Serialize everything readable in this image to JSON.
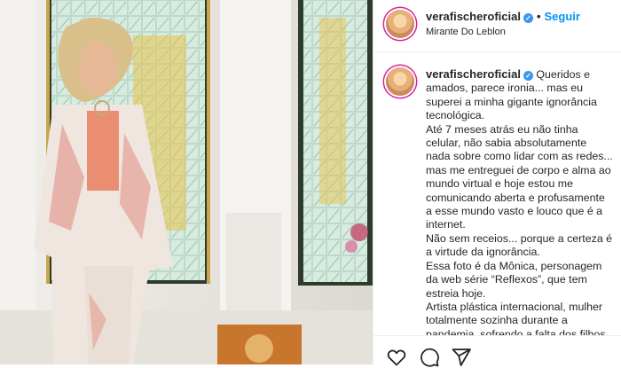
{
  "post": {
    "username": "verafischeroficial",
    "verified_mark": "✓",
    "follow_label": "Seguir",
    "location": "Mirante Do Leblon"
  },
  "caption": {
    "username": "verafischeroficial",
    "lines": [
      "Queridos e amados, parece ironia... mas eu superei a minha gigante ignorância tecnológica.",
      "Até 7 meses atrás eu não tinha celular, não sabia absolutamente nada sobre como lidar com as redes... mas me entreguei de corpo e alma ao mundo virtual e hoje estou me comunicando aberta e profusamente a esse mundo vasto e louco que é a internet.",
      "Não sem receios... porque a certeza é a virtude da ignorância.",
      "Essa foto é da Mônica, personagem da web série “Reflexos”, que tem estreia hoje.",
      "Artista plástica internacional, mulher totalmente sozinha durante a pandemia, sofrendo a falta dos filhos"
    ]
  },
  "actions": {
    "icons": [
      "heart-icon",
      "comment-icon",
      "share-icon"
    ]
  },
  "colors": {
    "accent": "#0095f6",
    "verified": "#3897f0",
    "text": "#262626",
    "divider": "#efefef"
  }
}
